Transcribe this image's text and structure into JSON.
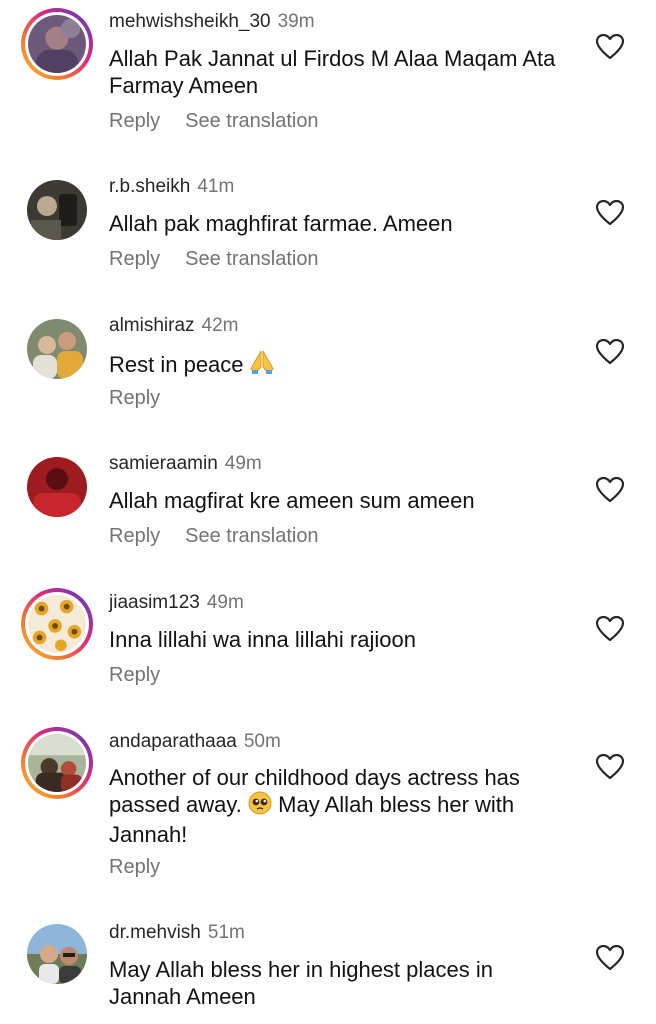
{
  "actions": {
    "reply": "Reply",
    "see_translation": "See translation"
  },
  "icons": {
    "like": "heart-outline-icon",
    "pray": "folded-hands-emoji",
    "pleading": "pleading-face-emoji"
  },
  "colors": {
    "text": "#262626",
    "secondary": "#737373",
    "story_ring": "#dd2a7b"
  },
  "comments": [
    {
      "username": "mehwishsheikh_30",
      "time": "39m",
      "text": "Allah Pak Jannat ul Firdos M Alaa Maqam Ata Farmay Ameen",
      "has_translation": true,
      "story_ring": true
    },
    {
      "username": "r.b.sheikh",
      "time": "41m",
      "text": "Allah pak maghfirat farmae. Ameen",
      "has_translation": true,
      "story_ring": false
    },
    {
      "username": "almishiraz",
      "time": "42m",
      "text": "Rest in peace",
      "has_translation": false,
      "story_ring": false
    },
    {
      "username": "samieraamin",
      "time": "49m",
      "text": "Allah magfirat kre ameen sum ameen",
      "has_translation": true,
      "story_ring": false
    },
    {
      "username": "jiaasim123",
      "time": "49m",
      "text": "Inna lillahi wa inna lillahi rajioon",
      "has_translation": false,
      "story_ring": true
    },
    {
      "username": "andaparathaaa",
      "time": "50m",
      "text_before": "Another of our childhood days actress has passed away.",
      "text_after": "May Allah bless her with Jannah!",
      "has_translation": false,
      "story_ring": true
    },
    {
      "username": "dr.mehvish",
      "time": "51m",
      "text": "May Allah bless her in highest places in Jannah Ameen",
      "has_translation": false,
      "story_ring": false
    }
  ]
}
